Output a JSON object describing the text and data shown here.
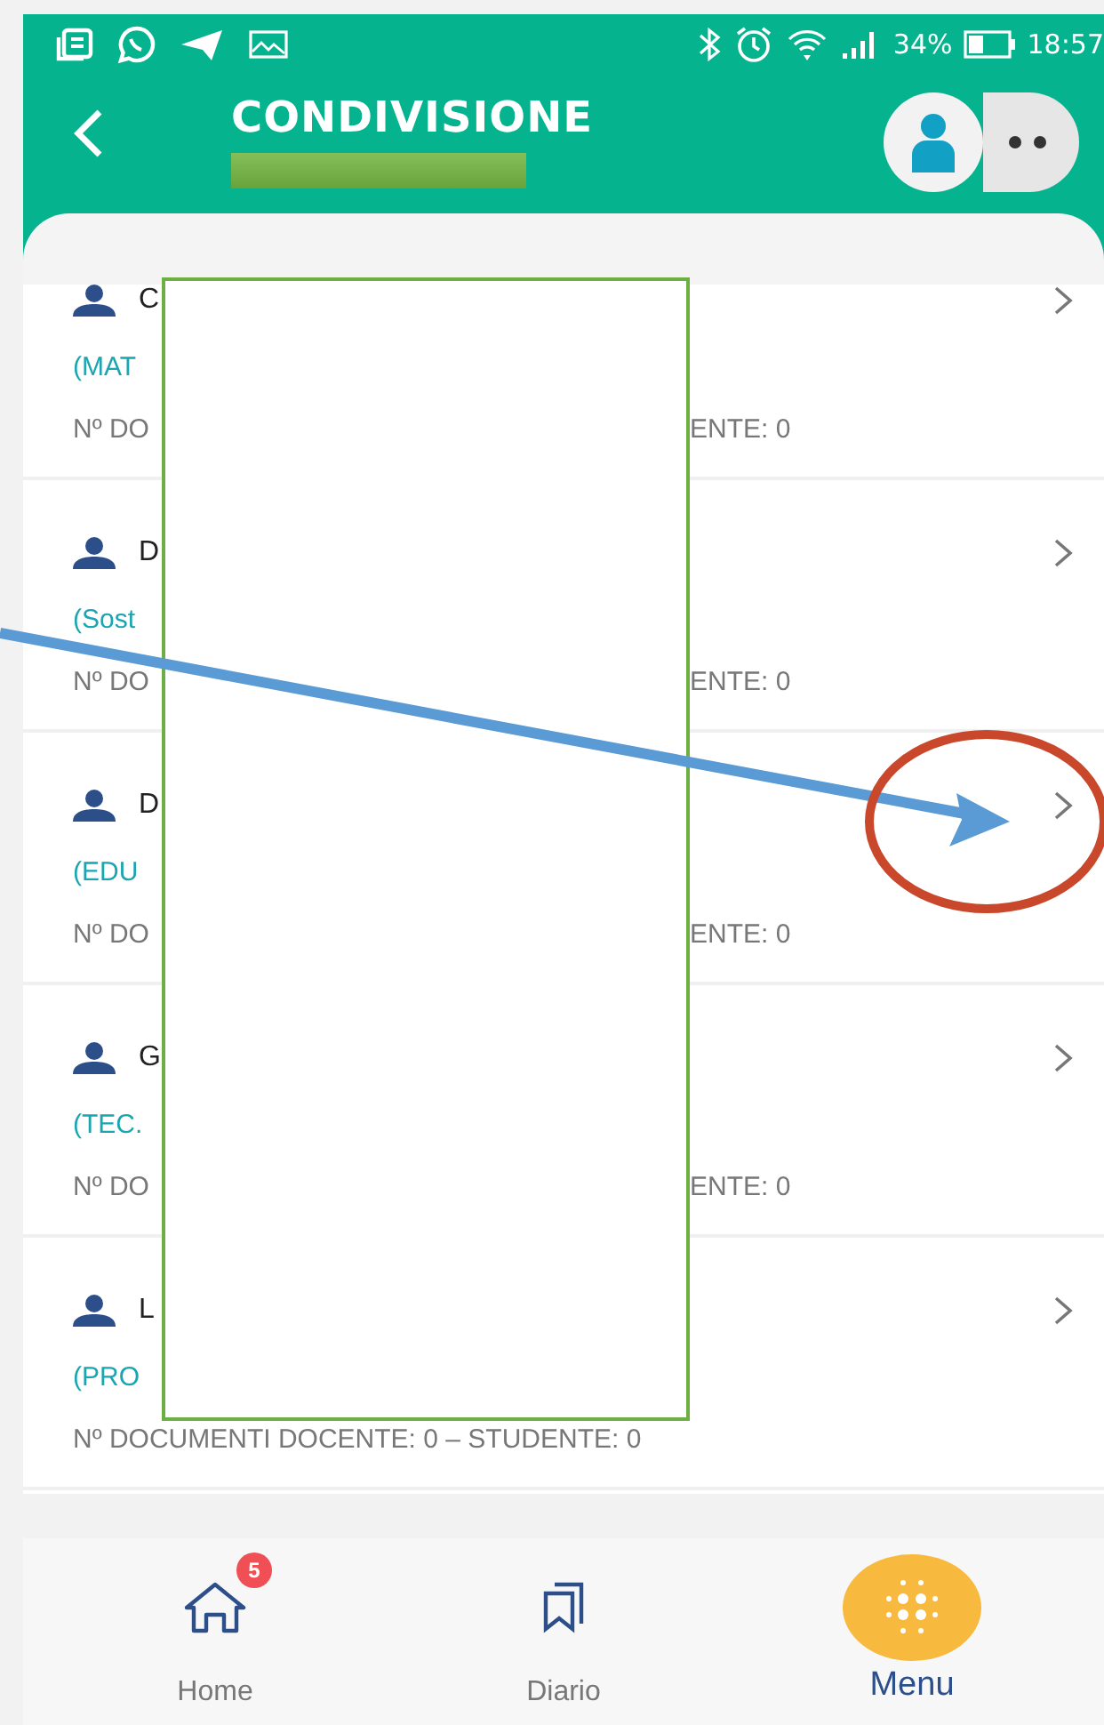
{
  "status_bar": {
    "battery": "34%",
    "time": "18:57"
  },
  "header": {
    "title": "CONDIVISIONE"
  },
  "rows": [
    {
      "name": "C",
      "subject": "(MAT",
      "docs_left": "Nº DO",
      "docs_right": "ENTE: 0"
    },
    {
      "name": "D",
      "subject": "(Sost",
      "docs_left": "Nº DO",
      "docs_right": "ENTE: 0"
    },
    {
      "name": "D",
      "subject": "(EDU",
      "docs_left": "Nº DO",
      "docs_right": "ENTE: 0"
    },
    {
      "name": "G",
      "subject": "(TEC.",
      "docs_left": "Nº DO",
      "docs_right": "ENTE: 0"
    },
    {
      "name": "L",
      "subject": "(PRO",
      "docs_left": "Nº DOCUMENTI DOCENTE: 0 – STUDENTE: 0"
    }
  ],
  "nav": [
    {
      "kind": "home",
      "label": "Home",
      "badge": "5",
      "selected": false
    },
    {
      "kind": "bookmarks",
      "label": "Diario",
      "selected": false
    },
    {
      "kind": "grid",
      "label": "Menu",
      "selected": true
    }
  ],
  "annotations": [
    {
      "kind": "redaction"
    },
    {
      "kind": "arrow"
    },
    {
      "kind": "circle"
    }
  ]
}
